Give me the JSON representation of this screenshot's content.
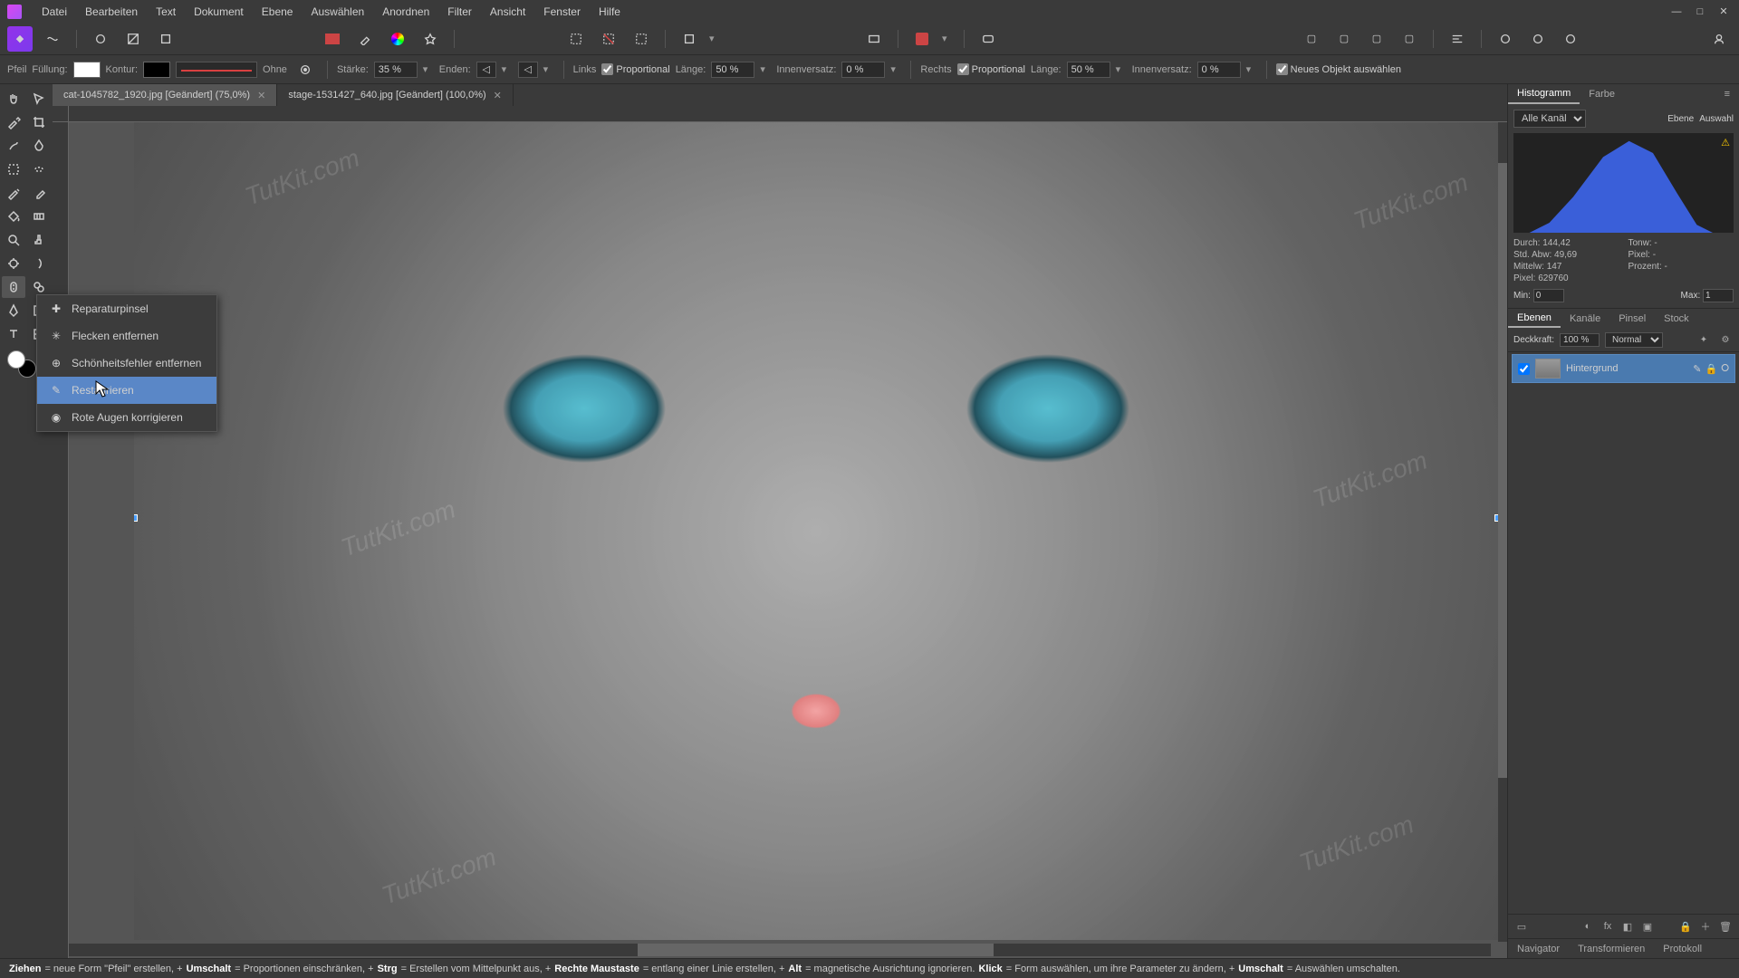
{
  "menu": [
    "Datei",
    "Bearbeiten",
    "Text",
    "Dokument",
    "Ebene",
    "Auswählen",
    "Anordnen",
    "Filter",
    "Ansicht",
    "Fenster",
    "Hilfe"
  ],
  "ctx": {
    "tool": "Pfeil",
    "fill_label": "Füllung:",
    "stroke_label": "Kontur:",
    "style_label": "Ohne",
    "strength_label": "Stärke:",
    "strength": "35 %",
    "ends_label": "Enden:",
    "left_label": "Links",
    "proportional": "Proportional",
    "length_label": "Länge:",
    "length_left": "50 %",
    "inset_label": "Innenversatz:",
    "inset_left": "0 %",
    "right_label": "Rechts",
    "length_right": "50 %",
    "inset_right": "0 %",
    "new_obj": "Neues Objekt auswählen"
  },
  "tabs": [
    {
      "name": "cat-1045782_1920.jpg [Geändert] (75,0%)",
      "active": true
    },
    {
      "name": "stage-1531427_640.jpg [Geändert] (100,0%)",
      "active": false
    }
  ],
  "flyout": [
    "Reparaturpinsel",
    "Flecken entfernen",
    "Schönheitsfehler entfernen",
    "Restaurieren",
    "Rote Augen korrigieren"
  ],
  "flyout_hover_index": 3,
  "hist": {
    "tab1": "Histogramm",
    "tab2": "Farbe",
    "channel": "Alle Kanäle",
    "btn_ebene": "Ebene",
    "btn_auswahl": "Auswahl",
    "stats": {
      "durch_label": "Durch:",
      "durch": "144,42",
      "stdabw_label": "Std. Abw:",
      "stdabw": "49,69",
      "mittelw_label": "Mittelw:",
      "mittelw": "147",
      "pixel_label": "Pixel:",
      "pixel": "629760",
      "tonw_label": "Tonw:",
      "tonw": "-",
      "pixel2_label": "Pixel:",
      "pixel2": "-",
      "prozent_label": "Prozent:",
      "prozent": "-"
    },
    "min_label": "Min:",
    "min": "0",
    "max_label": "Max:",
    "max": "1"
  },
  "layers": {
    "tab1": "Ebenen",
    "tab2": "Kanäle",
    "tab3": "Pinsel",
    "tab4": "Stock",
    "opacity_label": "Deckkraft:",
    "opacity": "100 %",
    "blend": "Normal",
    "layer_name": "Hintergrund"
  },
  "bottom_tabs": [
    "Navigator",
    "Transformieren",
    "Protokoll"
  ],
  "status": {
    "s1": "Ziehen",
    "s1t": " = neue Form \"Pfeil\" erstellen, +",
    "s2": "Umschalt",
    "s2t": " = Proportionen einschränken, +",
    "s3": "Strg",
    "s3t": " = Erstellen vom Mittelpunkt aus, +",
    "s4": "Rechte Maustaste",
    "s4t": " = entlang einer Linie erstellen, +",
    "s5": "Alt",
    "s5t": " = magnetische Ausrichtung ignorieren. ",
    "s6": "Klick",
    "s6t": " = Form auswählen, um ihre Parameter zu ändern, +",
    "s7": "Umschalt",
    "s7t": " = Auswählen umschalten."
  },
  "watermark_text": "TutKit.com",
  "chart_data": {
    "type": "area",
    "title": "Histogramm",
    "xlabel": "",
    "ylabel": "",
    "x": [
      0,
      32,
      64,
      96,
      128,
      160,
      192,
      224,
      255
    ],
    "values": [
      0,
      2,
      12,
      40,
      88,
      100,
      65,
      18,
      0
    ],
    "ylim": [
      0,
      100
    ],
    "series_name": "Alle Kanäle",
    "color": "#3a5fd9"
  }
}
